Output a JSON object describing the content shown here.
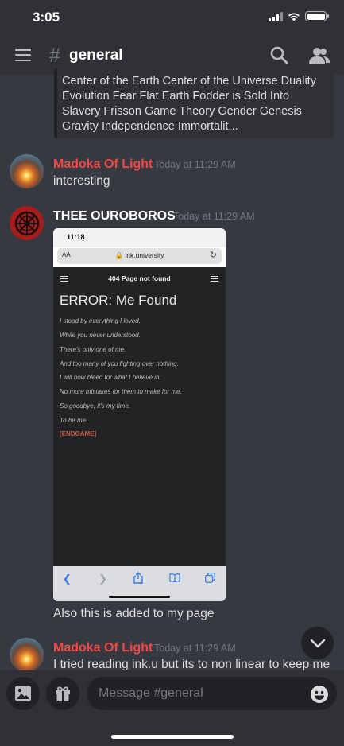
{
  "status_bar": {
    "time": "3:05"
  },
  "header": {
    "hash": "#",
    "channel": "general"
  },
  "embed_top": {
    "text": "Center of the Earth Center of the Universe Duality Evolution Fear Flat Earth Fodder is Sold Into Slavery Frisson Game Theory Gender Genesis Gravity Independence Immortalit..."
  },
  "messages": [
    {
      "author": "Madoka Of Light",
      "author_color": "#f04747",
      "timestamp": "Today at 11:29 AM",
      "text": "interesting"
    },
    {
      "author": "THEE OUROBOROS",
      "author_color": "#ffffff",
      "timestamp": "Today at 11:29 AM",
      "text": "Also this is added to my page"
    },
    {
      "author": "Madoka Of Light",
      "author_color": "#f04747",
      "timestamp": "Today at 11:29 AM",
      "text": "I tried reading ink.u but its to non linear to keep me"
    }
  ],
  "attachment": {
    "status_time": "11:18",
    "aa": "AA",
    "url": "ink.university",
    "nav_title": "404 Page not found",
    "heading": "ERROR: Me Found",
    "lines": [
      "I stood by everything I loved.",
      "While you never understood.",
      "There's only one of me.",
      "And too many of you fighting over nothing.",
      "I will now bleed for what I believe in.",
      "No more mistakes for them to make for me.",
      "So goodbye, it's my time.",
      "To be me."
    ],
    "endgame": "[ENDGAME]"
  },
  "composer": {
    "placeholder": "Message #general"
  }
}
